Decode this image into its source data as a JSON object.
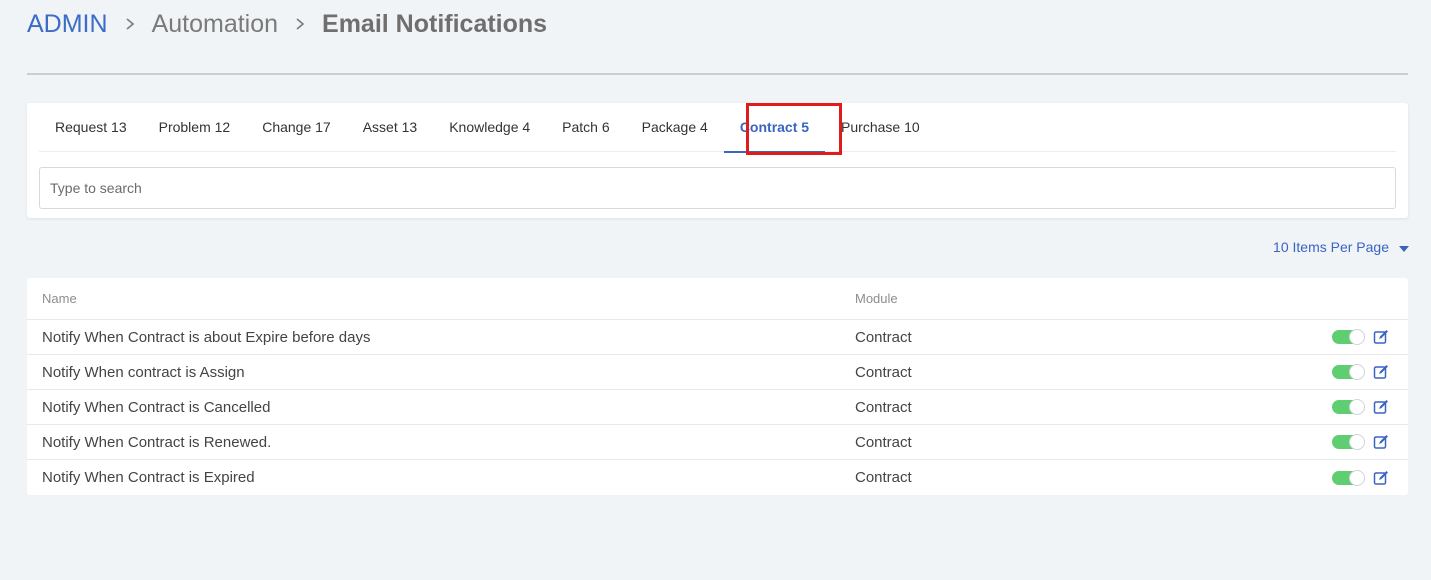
{
  "breadcrumb": {
    "root": "ADMIN",
    "middle": "Automation",
    "current": "Email Notifications"
  },
  "tabs": [
    {
      "label": "Request 13",
      "active": false
    },
    {
      "label": "Problem 12",
      "active": false
    },
    {
      "label": "Change 17",
      "active": false
    },
    {
      "label": "Asset 13",
      "active": false
    },
    {
      "label": "Knowledge 4",
      "active": false
    },
    {
      "label": "Patch 6",
      "active": false
    },
    {
      "label": "Package 4",
      "active": false
    },
    {
      "label": "Contract 5",
      "active": true
    },
    {
      "label": "Purchase 10",
      "active": false
    }
  ],
  "search": {
    "placeholder": "Type to search",
    "value": ""
  },
  "pagination": {
    "per_page_label": "10 Items Per Page"
  },
  "table": {
    "headers": {
      "name": "Name",
      "module": "Module"
    },
    "rows": [
      {
        "name": "Notify When Contract is about Expire before days",
        "module": "Contract",
        "enabled": true
      },
      {
        "name": "Notify When contract is Assign",
        "module": "Contract",
        "enabled": true
      },
      {
        "name": "Notify When Contract is Cancelled",
        "module": "Contract",
        "enabled": true
      },
      {
        "name": "Notify When Contract is Renewed.",
        "module": "Contract",
        "enabled": true
      },
      {
        "name": "Notify When Contract is Expired",
        "module": "Contract",
        "enabled": true
      }
    ]
  },
  "colors": {
    "accent": "#3a63c2",
    "toggle_on": "#5fce70",
    "highlight": "#e01b1b",
    "background": "#f0f4f7"
  },
  "icons": {
    "separator": "chevron-right-icon",
    "dropdown": "caret-down-icon",
    "edit": "edit-icon"
  }
}
